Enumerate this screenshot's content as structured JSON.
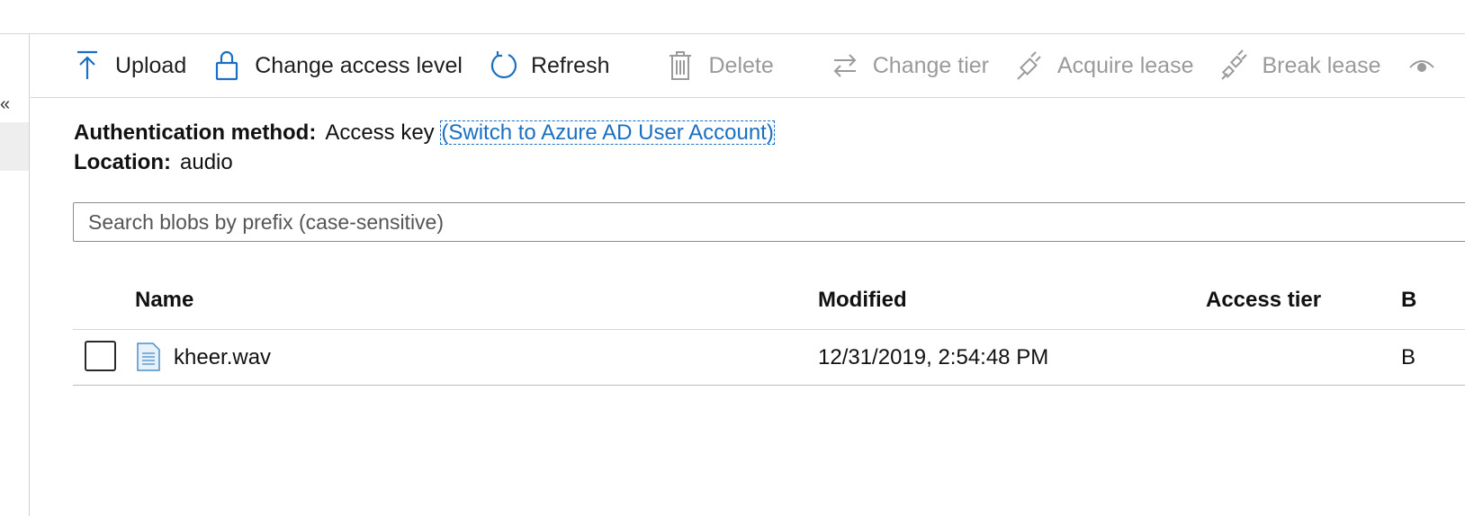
{
  "nav": {
    "collapse_glyph": "«"
  },
  "toolbar": {
    "upload": "Upload",
    "change_access_level": "Change access level",
    "refresh": "Refresh",
    "delete": "Delete",
    "change_tier": "Change tier",
    "acquire_lease": "Acquire lease",
    "break_lease": "Break lease"
  },
  "info": {
    "auth_label": "Authentication method:",
    "auth_value": "Access key",
    "auth_switch_link": "(Switch to Azure AD User Account)",
    "location_label": "Location:",
    "location_value": "audio"
  },
  "search": {
    "placeholder": "Search blobs by prefix (case-sensitive)"
  },
  "grid": {
    "columns": [
      "Name",
      "Modified",
      "Access tier",
      "B"
    ],
    "rows": [
      {
        "name": "kheer.wav",
        "modified": "12/31/2019, 2:54:48 PM",
        "access_tier": "",
        "b": "B"
      }
    ]
  },
  "colors": {
    "accent": "#1a6fc0",
    "disabled": "#9a9a9a"
  }
}
